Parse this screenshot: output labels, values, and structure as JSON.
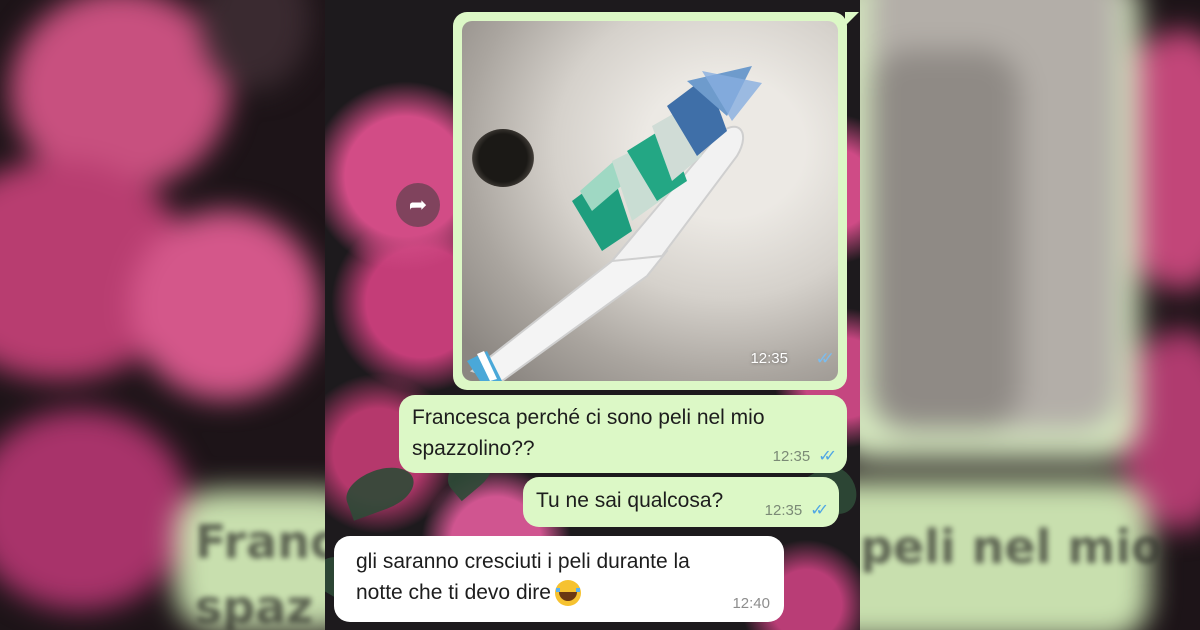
{
  "chat": {
    "messages": [
      {
        "type": "image",
        "direction": "outgoing",
        "image_description_icon": "toothbrush-photo",
        "time": "12:35",
        "status": "read"
      },
      {
        "type": "text",
        "direction": "outgoing",
        "line1": "Francesca perché ci sono peli nel mio",
        "line2": "spazzolino??",
        "time": "12:35",
        "status": "read"
      },
      {
        "type": "text",
        "direction": "outgoing",
        "text": "Tu ne sai qualcosa?",
        "time": "12:35",
        "status": "read"
      },
      {
        "type": "text",
        "direction": "incoming",
        "line1": "gli saranno cresciuti i peli durante la",
        "line2": "notte che ti devo dire",
        "emoji": "face-with-tears-of-joy",
        "time": "12:40"
      }
    ],
    "forward_icon": "forward-arrow-icon",
    "read_ticks": "✓✓"
  },
  "colors": {
    "outgoing_bubble": "#dcf8c6",
    "incoming_bubble": "#ffffff",
    "read_ticks": "#4fa6e4"
  }
}
